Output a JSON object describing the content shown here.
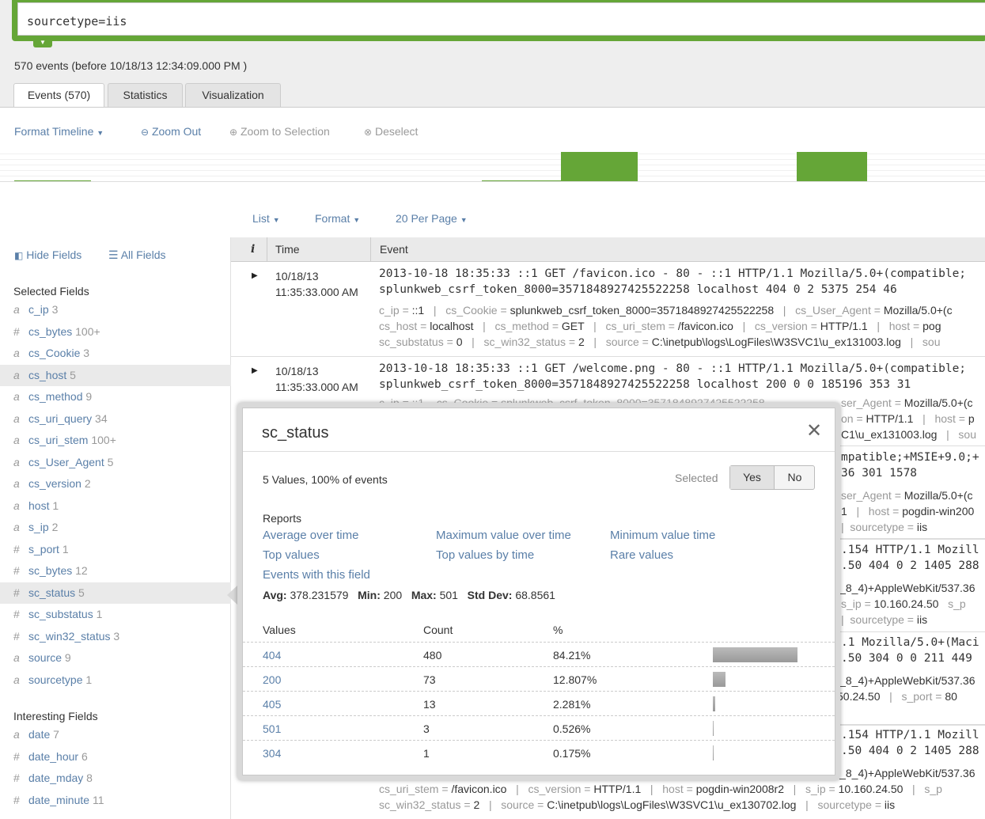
{
  "search": {
    "query": "sourcetype=iis"
  },
  "event_count": "570 events (before 10/18/13 12:34:09.000 PM )",
  "tabs": [
    "Events (570)",
    "Statistics",
    "Visualization"
  ],
  "timeline_controls": {
    "format": "Format Timeline",
    "zoom_out": "Zoom Out",
    "zoom_sel": "Zoom to Selection",
    "deselect": "Deselect"
  },
  "list_controls": {
    "list": "List",
    "format": "Format",
    "per_page": "20 Per Page"
  },
  "sidebar": {
    "hide": "Hide Fields",
    "all": "All Fields",
    "selected_title": "Selected Fields",
    "selected": [
      {
        "type": "a",
        "name": "c_ip",
        "count": "3"
      },
      {
        "type": "#",
        "name": "cs_bytes",
        "count": "100+"
      },
      {
        "type": "a",
        "name": "cs_Cookie",
        "count": "3"
      },
      {
        "type": "a",
        "name": "cs_host",
        "count": "5"
      },
      {
        "type": "a",
        "name": "cs_method",
        "count": "9"
      },
      {
        "type": "a",
        "name": "cs_uri_query",
        "count": "34"
      },
      {
        "type": "a",
        "name": "cs_uri_stem",
        "count": "100+"
      },
      {
        "type": "a",
        "name": "cs_User_Agent",
        "count": "5"
      },
      {
        "type": "a",
        "name": "cs_version",
        "count": "2"
      },
      {
        "type": "a",
        "name": "host",
        "count": "1"
      },
      {
        "type": "a",
        "name": "s_ip",
        "count": "2"
      },
      {
        "type": "#",
        "name": "s_port",
        "count": "1"
      },
      {
        "type": "#",
        "name": "sc_bytes",
        "count": "12"
      },
      {
        "type": "#",
        "name": "sc_status",
        "count": "5"
      },
      {
        "type": "#",
        "name": "sc_substatus",
        "count": "1"
      },
      {
        "type": "#",
        "name": "sc_win32_status",
        "count": "3"
      },
      {
        "type": "a",
        "name": "source",
        "count": "9"
      },
      {
        "type": "a",
        "name": "sourcetype",
        "count": "1"
      }
    ],
    "interesting_title": "Interesting Fields",
    "interesting": [
      {
        "type": "a",
        "name": "date",
        "count": "7"
      },
      {
        "type": "#",
        "name": "date_hour",
        "count": "6"
      },
      {
        "type": "#",
        "name": "date_mday",
        "count": "8"
      },
      {
        "type": "#",
        "name": "date_minute",
        "count": "11"
      }
    ]
  },
  "table": {
    "col_i": "i",
    "col_time": "Time",
    "col_event": "Event",
    "row1": {
      "date": "10/18/13",
      "time": "11:35:33.000 AM",
      "line1": "2013-10-18 18:35:33 ::1 GET /favicon.ico - 80 - ::1 HTTP/1.1 Mozilla/5.0+(compatible;",
      "line2": "splunkweb_csrf_token_8000=3571848927425522258 localhost 404 0 2 5375 254 46",
      "kv1": [
        [
          "c_ip",
          "::1"
        ],
        [
          "cs_Cookie",
          "splunkweb_csrf_token_8000=3571848927425522258"
        ],
        [
          "cs_User_Agent",
          "Mozilla/5.0+(c"
        ]
      ],
      "kv2": [
        [
          "cs_host",
          "localhost"
        ],
        [
          "cs_method",
          "GET"
        ],
        [
          "cs_uri_stem",
          "/favicon.ico"
        ],
        [
          "cs_version",
          "HTTP/1.1"
        ],
        [
          "host",
          "pog"
        ]
      ],
      "kv3": [
        [
          "sc_substatus",
          "0"
        ],
        [
          "sc_win32_status",
          "2"
        ],
        [
          "source",
          "C:\\inetpub\\logs\\LogFiles\\W3SVC1\\u_ex131003.log"
        ],
        [
          "sou",
          ""
        ]
      ]
    },
    "row2": {
      "date": "10/18/13",
      "time": "11:35:33.000 AM",
      "line1": "2013-10-18 18:35:33 ::1 GET /welcome.png - 80 - ::1 HTTP/1.1 Mozilla/5.0+(compatible;",
      "line2": "splunkweb_csrf_token_8000=3571848927425522258 localhost 200 0 0 185196 353 31",
      "partial": "c_ip = ::1    cs_Cookie = splunkweb_csrf_token_8000=3571848927425522258"
    },
    "frags": {
      "f1a": "ser_Agent",
      "f1b": "Mozilla/5.0+(c",
      "f2a": "on",
      "f2b": "HTTP/1.1",
      "f2c": "host",
      "f2d": "p",
      "f3a": "C1\\u_ex131003.log",
      "f3b": "sou",
      "f4": "mpatible;+MSIE+9.0;+",
      "f5": "36 301 1578",
      "f6a": "ser_Agent",
      "f6b": "Mozilla/5.0+(c",
      "f7a": "1",
      "f7b": "host",
      "f7c": "pogdin-win200",
      "f8a": "sourcetype",
      "f8b": "iis",
      "f9": ".154 HTTP/1.1 Mozill",
      "f10": ".50 404 0 2 1405 288",
      "f11": "l_8_4)+AppleWebKit/537.36",
      "f12a": "s_ip",
      "f12b": "10.160.24.50",
      "f12c": "s_p",
      "f13a": "sourcetype",
      "f13b": "iis",
      "f14": ".1 Mozilla/5.0+(Maci",
      "f15": ".50 304 0 0 211 449",
      "f16": "l_8_4)+AppleWebKit/537.36",
      "f17a": "50.24.50",
      "f17b": "s_port",
      "f17c": "80",
      "f18": ".154 HTTP/1.1 Mozill",
      "f19": ".50 404 0 2 1405 288",
      "f20": "l_8_4)+AppleWebKit/537.36",
      "b1": [
        [
          "cs_uri_stem",
          "/favicon.ico"
        ],
        [
          "cs_version",
          "HTTP/1.1"
        ],
        [
          "host",
          "pogdin-win2008r2"
        ],
        [
          "s_ip",
          "10.160.24.50"
        ],
        [
          "s_p",
          ""
        ]
      ],
      "b2": [
        [
          "sc_win32_status",
          "2"
        ],
        [
          "source",
          "C:\\inetpub\\logs\\LogFiles\\W3SVC1\\u_ex130702.log"
        ],
        [
          "sourcetype",
          "iis"
        ]
      ]
    }
  },
  "popup": {
    "title": "sc_status",
    "close": "✕",
    "summary": "5 Values, 100% of events",
    "selected_label": "Selected",
    "yes": "Yes",
    "no": "No",
    "reports_title": "Reports",
    "reports": [
      "Average over time",
      "Maximum value over time",
      "Minimum value time",
      "Top values",
      "Top values by time",
      "Rare values",
      "Events with this field"
    ],
    "stats": {
      "avg_label": "Avg:",
      "avg": "378.231579",
      "min_label": "Min:",
      "min": "200",
      "max_label": "Max:",
      "max": "501",
      "sd_label": "Std Dev:",
      "sd": "68.8561"
    },
    "head_values": "Values",
    "head_count": "Count",
    "head_pct": "%",
    "values": [
      {
        "value": "404",
        "count": "480",
        "pct": "84.21%",
        "fraction": 0.8421
      },
      {
        "value": "200",
        "count": "73",
        "pct": "12.807%",
        "fraction": 0.12807
      },
      {
        "value": "405",
        "count": "13",
        "pct": "2.281%",
        "fraction": 0.02281
      },
      {
        "value": "501",
        "count": "3",
        "pct": "0.526%",
        "fraction": 0.00526
      },
      {
        "value": "304",
        "count": "1",
        "pct": "0.175%",
        "fraction": 0.00175
      }
    ]
  }
}
